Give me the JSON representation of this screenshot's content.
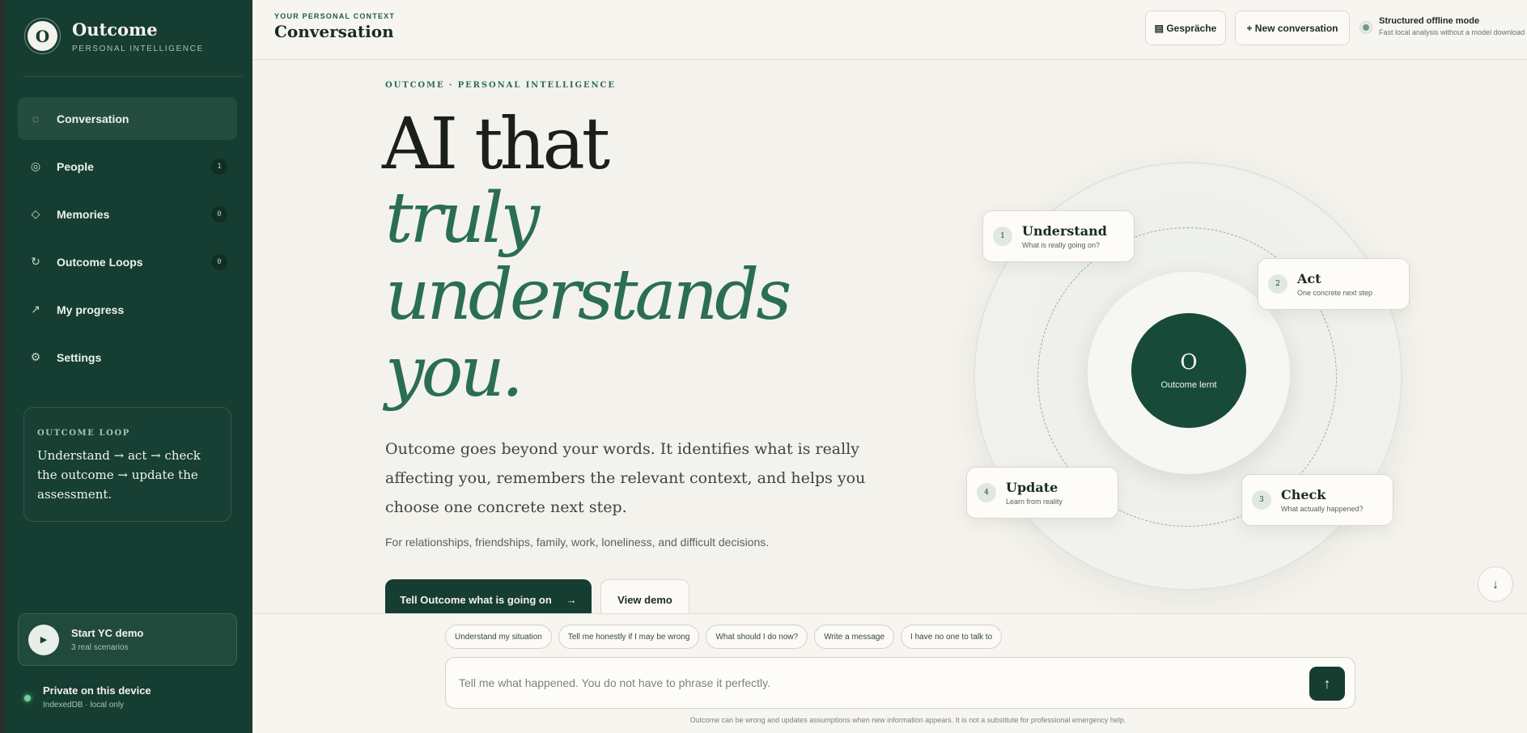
{
  "brand": {
    "logo_letter": "O",
    "title": "Outcome",
    "subtitle": "PERSONAL INTELLIGENCE"
  },
  "sidebar": {
    "items": [
      {
        "icon": "circle-icon",
        "glyph": "◌",
        "label": "Conversation",
        "badge": null,
        "active": true
      },
      {
        "icon": "people-icon",
        "glyph": "◎",
        "label": "People",
        "badge": "1",
        "active": false
      },
      {
        "icon": "diamond-icon",
        "glyph": "◇",
        "label": "Memories",
        "badge": "0",
        "active": false
      },
      {
        "icon": "refresh-icon",
        "glyph": "↻",
        "label": "Outcome Loops",
        "badge": "0",
        "active": false
      },
      {
        "icon": "trend-arrow-icon",
        "glyph": "↗",
        "label": "My progress",
        "badge": null,
        "active": false
      },
      {
        "icon": "gear-icon",
        "glyph": "⚙",
        "label": "Settings",
        "badge": null,
        "active": false
      }
    ],
    "loop_card": {
      "kicker": "OUTCOME LOOP",
      "text": "Understand → act → check the outcome → update the assessment."
    },
    "demo": {
      "play_glyph": "▶",
      "title": "Start YC demo",
      "subtitle": "3 real scenarios"
    },
    "private": {
      "title": "Private on this device",
      "subtitle": "IndexedDB · local only"
    }
  },
  "header": {
    "kicker": "YOUR PERSONAL CONTEXT",
    "title": "Conversation",
    "conversations_label": "▤ Gespräche",
    "new_conversation_label": "+ New conversation",
    "offline_title": "Structured offline mode",
    "offline_subtitle": "Fast local analysis without a model download"
  },
  "hero": {
    "kicker": "OUTCOME · PERSONAL INTELLIGENCE",
    "line1": "AI that",
    "line2": "truly",
    "line3": "understands",
    "line4": "you.",
    "description": "Outcome goes beyond your words. It identifies what is really affecting you, remembers the relevant context, and helps you choose one concrete next step.",
    "small": "For relationships, friendships, family, work, loneliness, and difficult decisions.",
    "cta_primary": "Tell Outcome what is going on",
    "cta_primary_arrow": "→",
    "cta_secondary": "View demo"
  },
  "diagram": {
    "core_letter": "O",
    "core_label": "Outcome lernt",
    "steps": [
      {
        "num": "1",
        "title": "Understand",
        "subtitle": "What is really going on?"
      },
      {
        "num": "2",
        "title": "Act",
        "subtitle": "One concrete next step"
      },
      {
        "num": "3",
        "title": "Check",
        "subtitle": "What actually happened?"
      },
      {
        "num": "4",
        "title": "Update",
        "subtitle": "Learn from reality"
      }
    ]
  },
  "scroll_glyph": "↓",
  "composer": {
    "chips": [
      "Understand my situation",
      "Tell me honestly if I may be wrong",
      "What should I do now?",
      "Write a message",
      "I have no one to talk to"
    ],
    "placeholder": "Tell me what happened. You do not have to phrase it perfectly.",
    "send_glyph": "↑",
    "disclaimer": "Outcome can be wrong and updates assumptions when new information appears. It is not a substitute for professional emergency help."
  },
  "colors": {
    "sidebar": "#163d31",
    "accent": "#2a6e54",
    "background": "#f4f2ec"
  }
}
